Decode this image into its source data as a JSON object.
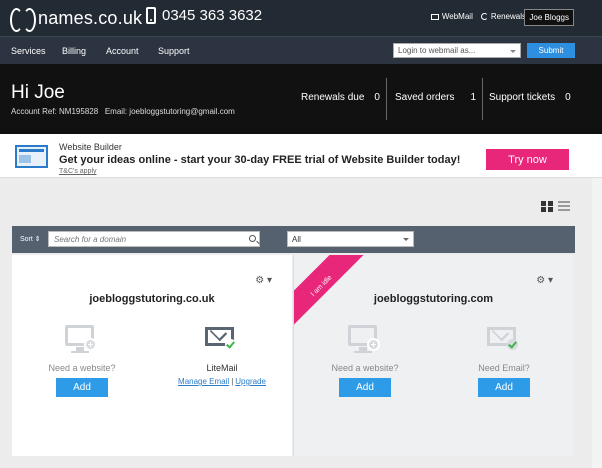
{
  "header": {
    "logo_text": "names.co.uk",
    "phone": "0345 363 3632",
    "links": [
      "WebMail",
      "Renewals"
    ],
    "user_button": "Joe Bloggs"
  },
  "nav": {
    "items": [
      "Services",
      "Billing",
      "Account",
      "Support"
    ],
    "webmail_placeholder": "Login to webmail as...",
    "submit_label": "Submit"
  },
  "greeting": {
    "hi": "Hi Joe",
    "account_ref": "Account Ref: NM195828",
    "email": "Email: joebloggstutoring@gmail.com",
    "stats": [
      {
        "label": "Renewals due",
        "value": "0"
      },
      {
        "label": "Saved orders",
        "value": "1"
      },
      {
        "label": "Support tickets",
        "value": "0"
      }
    ]
  },
  "promo": {
    "title": "Website Builder",
    "text": "Get your ideas online - start your 30-day FREE trial of Website Builder today!",
    "terms": "T&C's apply",
    "cta": "Try now"
  },
  "filter": {
    "sort_label": "Sort ⇕",
    "search_placeholder": "Search for a domain",
    "select_value": "All"
  },
  "cards": [
    {
      "domain": "joebloggstutoring.co.uk",
      "website_label": "Need a website?",
      "website_button": "Add",
      "mail_label": "LiteMail",
      "mail_links": [
        "Manage Email",
        "Upgrade"
      ]
    },
    {
      "domain": "joebloggstutoring.com",
      "ribbon": "I am idle",
      "website_label": "Need a website?",
      "website_button": "Add",
      "mail_label": "Need Email?",
      "mail_button": "Add"
    }
  ],
  "colors": {
    "header_bg": "#222a33",
    "accent_blue": "#2e9be8",
    "accent_pink": "#e8267a"
  }
}
